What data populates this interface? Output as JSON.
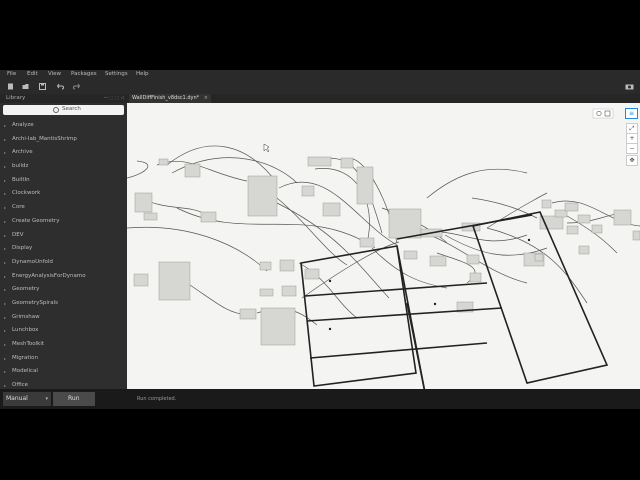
{
  "menu": [
    "File",
    "Edit",
    "View",
    "Packages",
    "Settings",
    "Help"
  ],
  "library": {
    "title": "Library",
    "controls": "ꟷ ⬚ ⬚ ◁",
    "search_placeholder": "Search",
    "items": [
      "Analyze",
      "Archi-lab_MantisShrimp",
      "Archive",
      "buildz",
      "BuiltIn",
      "Clockwork",
      "Core",
      "Create Geometry",
      "DEV",
      "Display",
      "DynamoUnfold",
      "EnergyAnalysisForDynamo",
      "Geometry",
      "GeometrySpirals",
      "Grimshaw",
      "Lunchbox",
      "MeshToolkit",
      "Migration",
      "Modelical",
      "Office"
    ]
  },
  "tab": {
    "label": "WallDiffFinish_v8dsc1.dyn*",
    "close": "×"
  },
  "run": {
    "mode": "Manual",
    "caret": "▾",
    "button": "Run"
  },
  "status": "Run completed.",
  "nav": {
    "zoom_in": "+",
    "zoom_out": "−",
    "fit": "⤢",
    "pan": "✥"
  },
  "colors": {
    "app_bg": "#1f1f1f",
    "canvas_bg": "#f4f4f2",
    "accent": "#1e88e5"
  }
}
